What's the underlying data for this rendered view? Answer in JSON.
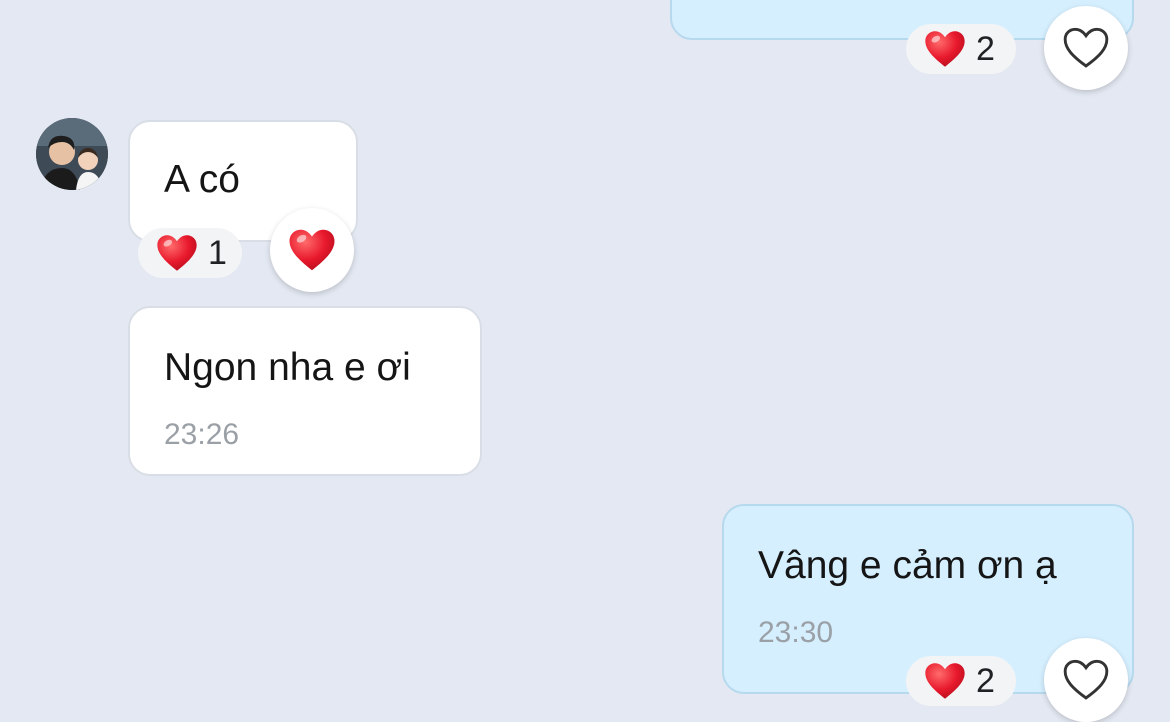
{
  "messages": [
    {
      "text": "A có"
    },
    {
      "text": "Ngon nha e ơi",
      "time": "23:26"
    },
    {
      "text": "Vâng e cảm ơn ạ",
      "time": "23:30"
    }
  ],
  "reactions": [
    {
      "count": "2"
    },
    {
      "count": "1"
    },
    {
      "count": "2"
    }
  ],
  "colors": {
    "background": "#e3e8f2",
    "incoming_bubble": "#ffffff",
    "outgoing_bubble": "#d5efff",
    "heart": "#e8192c"
  },
  "icons": [
    "heart-outline-icon",
    "heart-filled-icon",
    "avatar"
  ]
}
